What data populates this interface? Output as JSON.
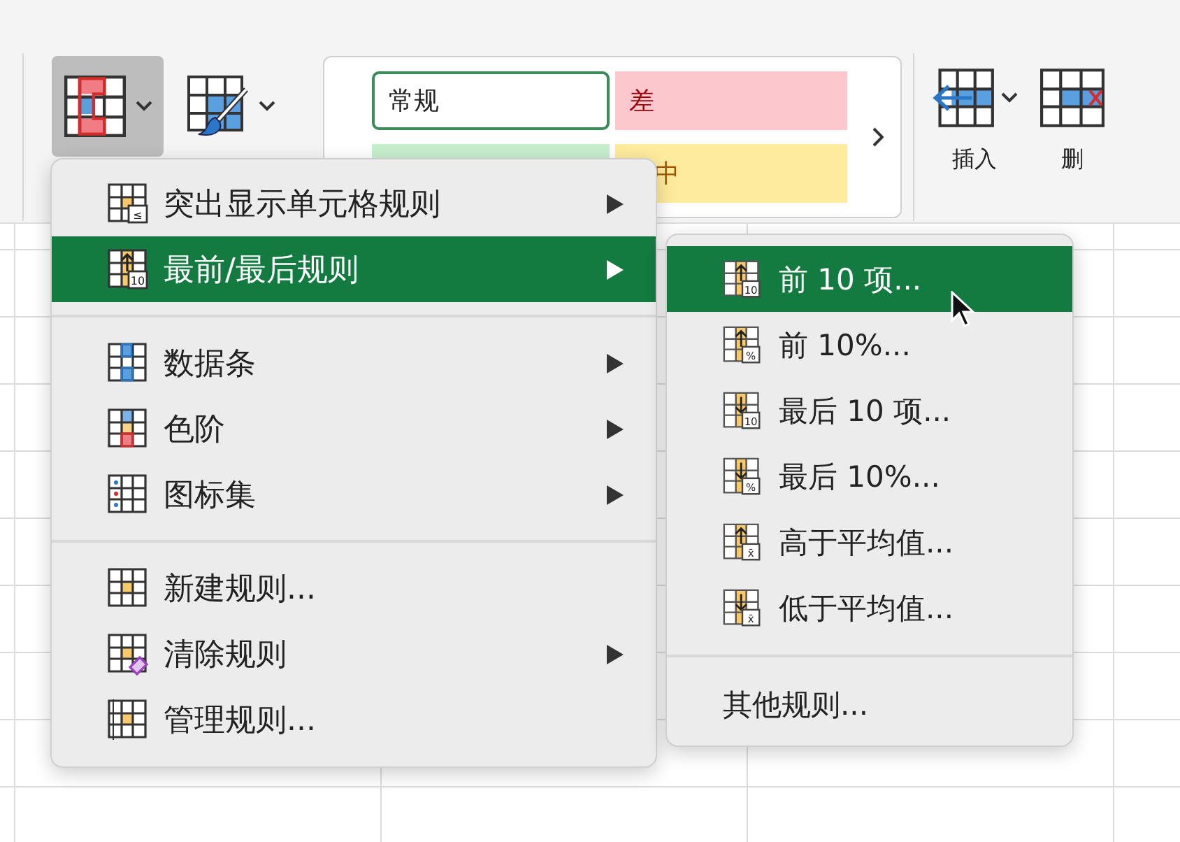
{
  "ribbon": {
    "conditional_formatting": {
      "pressed": true
    },
    "styles": [
      {
        "kind": "normal",
        "label": "常规"
      },
      {
        "kind": "bad",
        "label": "差"
      },
      {
        "kind": "good"
      },
      {
        "kind": "neutral",
        "label": "中"
      }
    ],
    "insert": {
      "label": "插入"
    },
    "delete": {
      "label": "删"
    }
  },
  "menu": {
    "groups": [
      {
        "items": [
          {
            "kind": "highlight",
            "badge": "≤",
            "label": "突出显示单元格规则",
            "has_submenu": true,
            "selected": false
          },
          {
            "kind": "topbottom",
            "badge": "10",
            "label": "最前/最后规则",
            "has_submenu": true,
            "selected": true
          }
        ]
      },
      {
        "items": [
          {
            "kind": "databar",
            "label": "数据条",
            "has_submenu": true,
            "selected": false
          },
          {
            "kind": "colorscale",
            "label": "色阶",
            "has_submenu": true,
            "selected": false
          },
          {
            "kind": "iconset",
            "label": "图标集",
            "has_submenu": true,
            "selected": false
          }
        ]
      },
      {
        "items": [
          {
            "kind": "new",
            "label": "新建规则...",
            "has_submenu": false,
            "selected": false
          },
          {
            "kind": "clear",
            "label": "清除规则",
            "has_submenu": true,
            "selected": false
          },
          {
            "kind": "manage",
            "label": "管理规则...",
            "has_submenu": false,
            "selected": false
          }
        ]
      }
    ]
  },
  "submenu": {
    "groups": [
      {
        "items": [
          {
            "kind": "top",
            "badge": "10",
            "label": "前 10 项...",
            "selected": true
          },
          {
            "kind": "top",
            "badge": "%",
            "label": "前 10%...",
            "selected": false
          },
          {
            "kind": "bottom",
            "badge": "10",
            "label": "最后 10 项...",
            "selected": false
          },
          {
            "kind": "bottom",
            "badge": "%",
            "label": "最后 10%...",
            "selected": false
          },
          {
            "kind": "top",
            "badge": "x̄",
            "label": "高于平均值...",
            "selected": false
          },
          {
            "kind": "bottom",
            "badge": "x̄",
            "label": "低于平均值...",
            "selected": false
          }
        ]
      },
      {
        "items": [
          {
            "kind": "plain",
            "label": "其他规则...",
            "selected": false
          }
        ]
      }
    ]
  }
}
